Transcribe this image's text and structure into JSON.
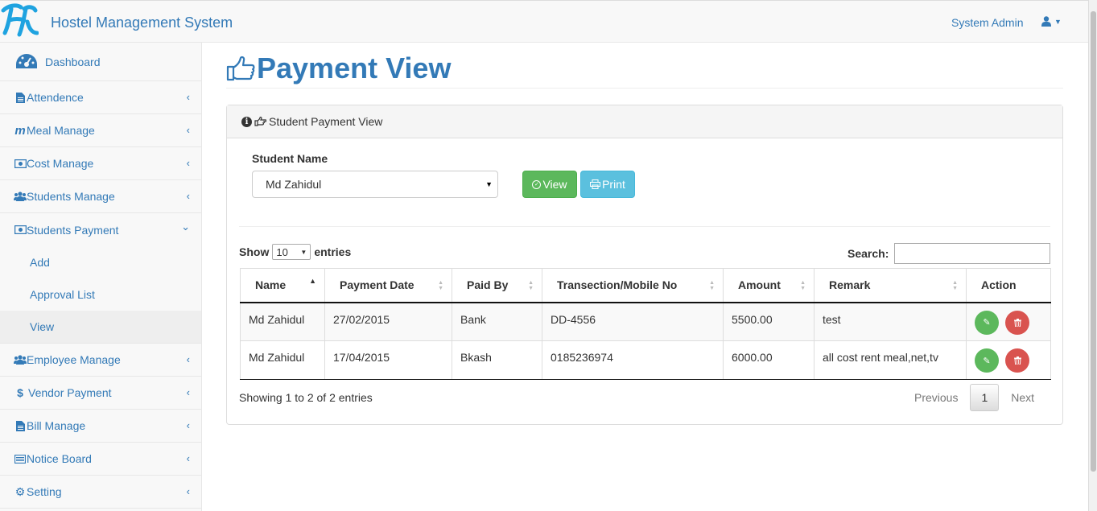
{
  "app": {
    "title": "Hostel Management System",
    "user": "System Admin"
  },
  "sidebar": {
    "dashboard": "Dashboard",
    "items": [
      {
        "label": "Attendence",
        "icon": "file-text-icon"
      },
      {
        "label": "Meal Manage",
        "icon": "meal-m-icon"
      },
      {
        "label": "Cost Manage",
        "icon": "money-icon"
      },
      {
        "label": "Students Manage",
        "icon": "users-icon"
      },
      {
        "label": "Students Payment",
        "icon": "money-icon",
        "expanded": true
      },
      {
        "label": "Employee Manage",
        "icon": "users-icon"
      },
      {
        "label": "Vendor Payment",
        "icon": "dollar-icon"
      },
      {
        "label": "Bill Manage",
        "icon": "file-text-icon"
      },
      {
        "label": "Notice Board",
        "icon": "list-icon"
      },
      {
        "label": "Setting",
        "icon": "gear-icon"
      }
    ],
    "payment_sub": [
      "Add",
      "Approval List",
      "View"
    ],
    "active_sub": "View"
  },
  "page": {
    "title": "Payment View",
    "panel_title": "Student Payment View"
  },
  "form": {
    "student_label": "Student Name",
    "student_value": "Md Zahidul",
    "view_label": "View",
    "print_label": "Print"
  },
  "table": {
    "show_label": "Show",
    "entries_label": "entries",
    "page_length": "10",
    "search_label": "Search:",
    "columns": [
      "Name",
      "Payment Date",
      "Paid By",
      "Transection/Mobile No",
      "Amount",
      "Remark",
      "Action"
    ],
    "rows": [
      [
        "Md Zahidul",
        "27/02/2015",
        "Bank",
        "DD-4556",
        "5500.00",
        "test"
      ],
      [
        "Md Zahidul",
        "17/04/2015",
        "Bkash",
        "0185236974",
        "6000.00",
        "all cost rent meal,net,tv"
      ]
    ],
    "info": "Showing 1 to 2 of 2 entries",
    "pager": {
      "previous": "Previous",
      "current": "1",
      "next": "Next"
    }
  },
  "colors": {
    "primary": "#337ab7",
    "success": "#5cb85c",
    "info": "#5bc0de",
    "danger": "#d9534f"
  }
}
